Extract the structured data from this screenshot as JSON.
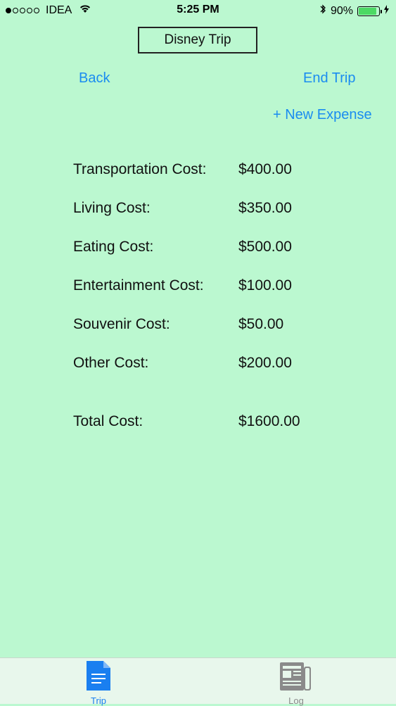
{
  "status_bar": {
    "carrier": "IDEA",
    "time": "5:25 PM",
    "battery_percent": "90%",
    "battery_level": 0.9,
    "signal_bars_filled": 1,
    "signal_bars_total": 5
  },
  "header": {
    "title": "Disney Trip"
  },
  "nav": {
    "back_label": "Back",
    "end_trip_label": "End Trip",
    "new_expense_label": "+ New Expense"
  },
  "costs": [
    {
      "label": "Transportation Cost:",
      "value": "$400.00"
    },
    {
      "label": "Living Cost:",
      "value": "$350.00"
    },
    {
      "label": "Eating Cost:",
      "value": "$500.00"
    },
    {
      "label": "Entertainment Cost:",
      "value": "$100.00"
    },
    {
      "label": "Souvenir Cost:",
      "value": "$50.00"
    },
    {
      "label": "Other Cost:",
      "value": "$200.00"
    }
  ],
  "total": {
    "label": "Total Cost:",
    "value": "$1600.00"
  },
  "tab_bar": {
    "tabs": [
      {
        "label": "Trip",
        "icon": "document-icon",
        "active": true
      },
      {
        "label": "Log",
        "icon": "newspaper-icon",
        "active": false
      }
    ]
  },
  "colors": {
    "background": "#bbf8d0",
    "accent": "#1a8cf0",
    "battery": "#4cd964"
  }
}
